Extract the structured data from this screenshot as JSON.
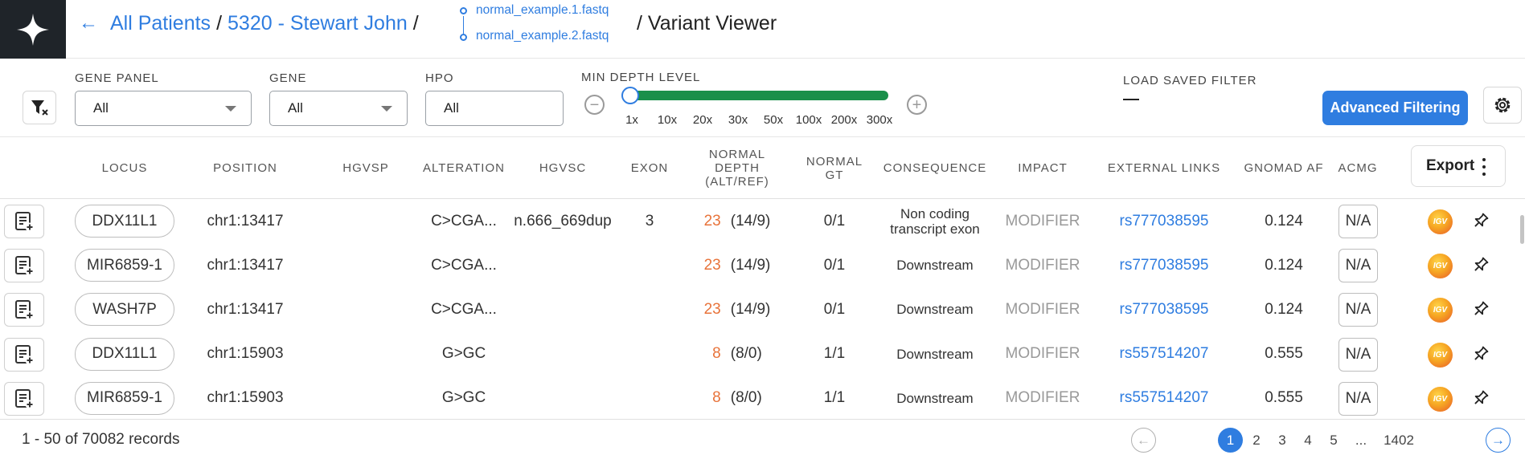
{
  "header": {
    "breadcrumb_root": "All Patients",
    "separator": "/",
    "patient": "5320 - Stewart John",
    "files": [
      "normal_example.1.fastq",
      "normal_example.2.fastq"
    ],
    "page_title": "/ Variant Viewer"
  },
  "filters": {
    "gene_panel": {
      "label": "GENE PANEL",
      "value": "All"
    },
    "gene": {
      "label": "GENE",
      "value": "All"
    },
    "hpo": {
      "label": "HPO",
      "value": "All"
    },
    "min_depth": {
      "label": "MIN DEPTH LEVEL",
      "ticks": [
        "1x",
        "10x",
        "20x",
        "30x",
        "50x",
        "100x",
        "200x",
        "300x"
      ],
      "selected": "1x"
    },
    "saved_filter": {
      "label": "LOAD SAVED FILTER",
      "value": "—"
    },
    "advanced_button": "Advanced Filtering"
  },
  "table": {
    "columns": [
      "LOCUS",
      "POSITION",
      "HGVSP",
      "ALTERATION",
      "HGVSC",
      "EXON",
      "NORMAL DEPTH (ALT/REF)",
      "NORMAL GT",
      "CONSEQUENCE",
      "IMPACT",
      "EXTERNAL LINKS",
      "GNOMAD AF",
      "ACMG"
    ],
    "export_label": "Export",
    "rows": [
      {
        "locus": "DDX11L1",
        "position": "chr1:13417",
        "hgvsp": "",
        "alteration": "C>CGA...",
        "hgvsc": "n.666_669dup",
        "exon": "3",
        "depth": "23",
        "depth_ratio": "(14/9)",
        "gt": "0/1",
        "consequence": "Non coding transcript exon",
        "impact": "MODIFIER",
        "link": "rs777038595",
        "af": "0.124",
        "acmg": "N/A"
      },
      {
        "locus": "MIR6859-1",
        "position": "chr1:13417",
        "hgvsp": "",
        "alteration": "C>CGA...",
        "hgvsc": "",
        "exon": "",
        "depth": "23",
        "depth_ratio": "(14/9)",
        "gt": "0/1",
        "consequence": "Downstream",
        "impact": "MODIFIER",
        "link": "rs777038595",
        "af": "0.124",
        "acmg": "N/A"
      },
      {
        "locus": "WASH7P",
        "position": "chr1:13417",
        "hgvsp": "",
        "alteration": "C>CGA...",
        "hgvsc": "",
        "exon": "",
        "depth": "23",
        "depth_ratio": "(14/9)",
        "gt": "0/1",
        "consequence": "Downstream",
        "impact": "MODIFIER",
        "link": "rs777038595",
        "af": "0.124",
        "acmg": "N/A"
      },
      {
        "locus": "DDX11L1",
        "position": "chr1:15903",
        "hgvsp": "",
        "alteration": "G>GC",
        "hgvsc": "",
        "exon": "",
        "depth": "8",
        "depth_ratio": "(8/0)",
        "gt": "1/1",
        "consequence": "Downstream",
        "impact": "MODIFIER",
        "link": "rs557514207",
        "af": "0.555",
        "acmg": "N/A"
      },
      {
        "locus": "MIR6859-1",
        "position": "chr1:15903",
        "hgvsp": "",
        "alteration": "G>GC",
        "hgvsc": "",
        "exon": "",
        "depth": "8",
        "depth_ratio": "(8/0)",
        "gt": "1/1",
        "consequence": "Downstream",
        "impact": "MODIFIER",
        "link": "rs557514207",
        "af": "0.555",
        "acmg": "N/A"
      }
    ]
  },
  "footer": {
    "records": "1 - 50 of 70082 records",
    "pages": [
      "1",
      "2",
      "3",
      "4",
      "5",
      "...",
      "1402"
    ],
    "current_page": "1"
  },
  "colors": {
    "accent": "#2f7de0",
    "slider": "#1a8f4a",
    "depth": "#e8733a",
    "logo_bg": "#1f2429"
  }
}
